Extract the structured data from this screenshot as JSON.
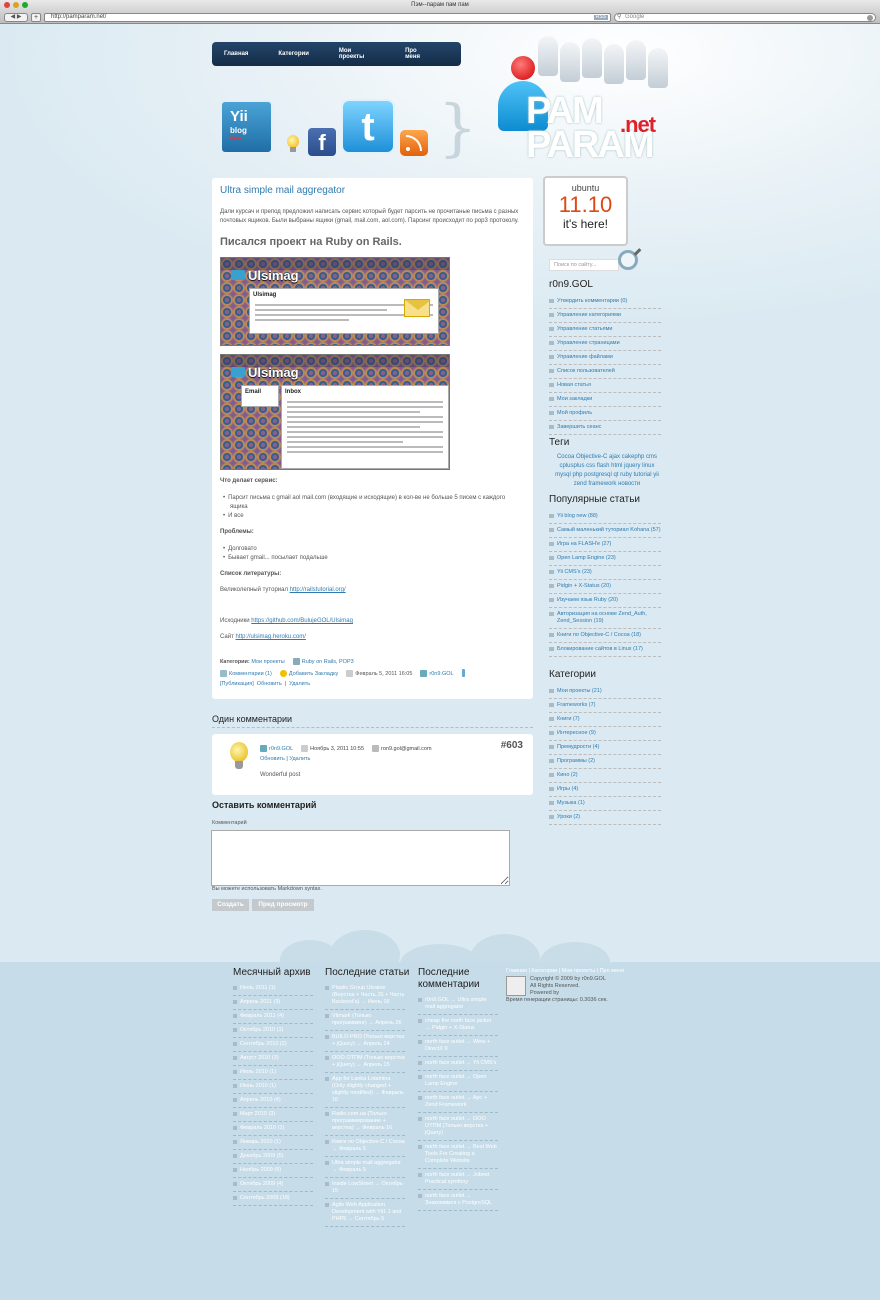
{
  "browser": {
    "title": "Пэм--парам пам пам",
    "back_label": "◀ ▶",
    "add_label": "+",
    "url": "http://pamparam.net/",
    "rss_badge": "RSS",
    "search_placeholder": "Google"
  },
  "nav": [
    "Главная",
    "Категории",
    "Мои проекты",
    "Про меня"
  ],
  "icons": {
    "yii_line1": "Yii",
    "yii_line2": "blog",
    "yii_badge": "new",
    "facebook": "f",
    "twitter": "t"
  },
  "logo": {
    "text1": "PAM",
    "text2": "PARAM",
    "net": ".net"
  },
  "post": {
    "title": "Ultra simple mail aggregator",
    "intro": "Дали курсач и препод предложил написать сервис который будет парсить не прочитаные письма с разных почтовых ящиков. Были выбраны ящики (gmail, mail.com, aol.com). Парсинг происходит по pop3 протоколу.",
    "heading": "Писался проект на Ruby on Rails.",
    "shot1_brand": "Ulsimag",
    "shot1_panel": "Ulsimag",
    "shot2_brand": "Ulsimag",
    "shot2_email": "Email",
    "shot2_inbox": "Inbox",
    "what_label": "Что делает сервис:",
    "what_items": [
      "Парсит письма с gmail aol mail.com (входящие и исходящие) в кол-ве не больше 5 писем с каждого ящика",
      "И все"
    ],
    "problems_label": "Проблемы:",
    "problems_items": [
      "Долговато",
      "Бывает gmail... посылает подальше"
    ],
    "lit_label": "Список литературы:",
    "lit_text": "Великолепный туториал",
    "lit_link": "http://railstutorial.org/",
    "src_text": "Исходники",
    "src_link": "https://github.com/BulujeGOL/Ulsimag",
    "site_text": "Сайт",
    "site_link": "http://ulsimag.heroku.com/",
    "cat_label": "Категории:",
    "cat_value": "Мои проекты",
    "tags_value": "Ruby on Rails, POP3",
    "comments_link": "Комментарии (1)",
    "bookmark_link": "Добавить Закладку",
    "date": "Февраль 5, 2011 16:05",
    "author": "r0n9.GOL",
    "published": "[Публикация]",
    "update": "Обновить",
    "delete": "Удалить"
  },
  "comments": {
    "heading": "Один комментарии",
    "author": "r0n9.GOL",
    "date": "Ноябрь 3, 2011 10:55",
    "email": "ron9.gol@gmail.com",
    "update": "Обновить",
    "delete": "Удалить",
    "number": "#603",
    "text": "Wonderful post"
  },
  "leave": {
    "heading": "Оставить комментарий",
    "label": "Комментарий",
    "hint": "Вы можете использовать Markdown syntax.",
    "create": "Создать",
    "preview": "Пред просмотр"
  },
  "sidebar": {
    "ubuntu": {
      "name": "ubuntu",
      "version": "11.10",
      "tagline": "it's here!"
    },
    "search_placeholder": "Поиск по сайту...",
    "user_heading": "r0n9.GOL",
    "user_menu": [
      "Утвердить комментарии (0)",
      "Управление категориями",
      "Управление статьями",
      "Управление страницами",
      "Управление файлами",
      "Список пользователей",
      "Новая статья",
      "Мои закладки",
      "Мой профиль",
      "Завершить сеанс"
    ],
    "tags_heading": "Теги",
    "tags": "Cocoa Objective-C ajax cakephp cms cplusplus css flash html jquery linux mysql php postgresql qt ruby tutorial yii zend framework новости",
    "popular_heading": "Популярные статьи",
    "popular": [
      "Yii blog new (88)",
      "Самый маленький туториал Kohana (57)",
      "Игра на FLASH'е (27)",
      "Open Lamp Engine (23)",
      "Yii CMS's (23)",
      "Pidgin + X-Status (20)",
      "Изучаем язык Ruby (20)",
      "Авторизация на основе Zend_Auth, Zend_Session (19)",
      "Книги по Objective-C / Cocoa (18)",
      "Блокирование сайтов в Linux (17)"
    ],
    "cats_heading": "Категории",
    "cats": [
      "Мои проекты (21)",
      "Frameworks (7)",
      "Книги (7)",
      "Интересное (9)",
      "Премудрости (4)",
      "Программы (2)",
      "Кино (2)",
      "Игры (4)",
      "Музыка (1)",
      "Уроки (2)"
    ]
  },
  "footer": {
    "archive_heading": "Месячный архив",
    "archive": [
      "Июль 2011 (1)",
      "Апрель 2011 (3)",
      "Февраль 2011 (4)",
      "Октябрь 2010 (1)",
      "Сентябрь 2010 (2)",
      "Август 2010 (3)",
      "Июль 2010 (1)",
      "Июнь 2010 (1)",
      "Апрель 2010 (4)",
      "Март 2010 (3)",
      "Февраль 2010 (1)",
      "Январь 2010 (1)",
      "Декабрь 2009 (5)",
      "Ноябрь 2009 (5)",
      "Октябрь 2009 (4)",
      "Сентябрь 2009 (18)"
    ],
    "recent_heading": "Последние статьи",
    "recent": [
      "Plastic Group Ukraine (Верстка + Часть JS + Часть Backend'а) → Июль 16",
      "Vitmark (Только программинг) → Апрель 26",
      "BUILD-PRO (Только верстка + jQuery) → Апрель 24",
      "ООО ОТПМ (Только верстка + jQuery) → Апрель 15",
      "App for Lanka Lotamina (Only slightly changed + slightly modified) → Февраль 16",
      "Radio.com.ua (Только программирование + верстка) → Февраль 16",
      "Книги по Objective-C / Cocoa → Февраль 5",
      "Ultra simple mail aggregator → Февраль 5",
      "Inside LowStreet → Октябрь 15",
      "Agile Web Application Development with Yii1.1 and PHP5 → Сентябрь 5"
    ],
    "comments_heading": "Последние комментарии",
    "comments": [
      "r0n9.GOL → Ultra simple mail aggregator",
      "cheap the north face jacket → Pidgin + X-Status",
      "north face outlet → Wine + DirectX 9",
      "north face outlet → Yii CMS's",
      "north face outlet → Open Lamp Engine",
      "north face outlet → Apc + Zend Framework",
      "north face outlet → ООО ОТПМ (Только верстка + jQuery)",
      "north face outlet → Best Web Tools For Creating a Complete Website",
      "north face outlet → Jobeet Practical symfony",
      "north face outlet → Знакомимся с PostgreSQL"
    ],
    "links": "Главная | Категории | Мои проекты | Про меня",
    "copyright": "Copyright © 2009 by r0n9.GOL",
    "rights": "All Rights Reserved.",
    "powered": "Powered by",
    "gen_time": "Время генерации страницы: 0.3036 сек."
  }
}
